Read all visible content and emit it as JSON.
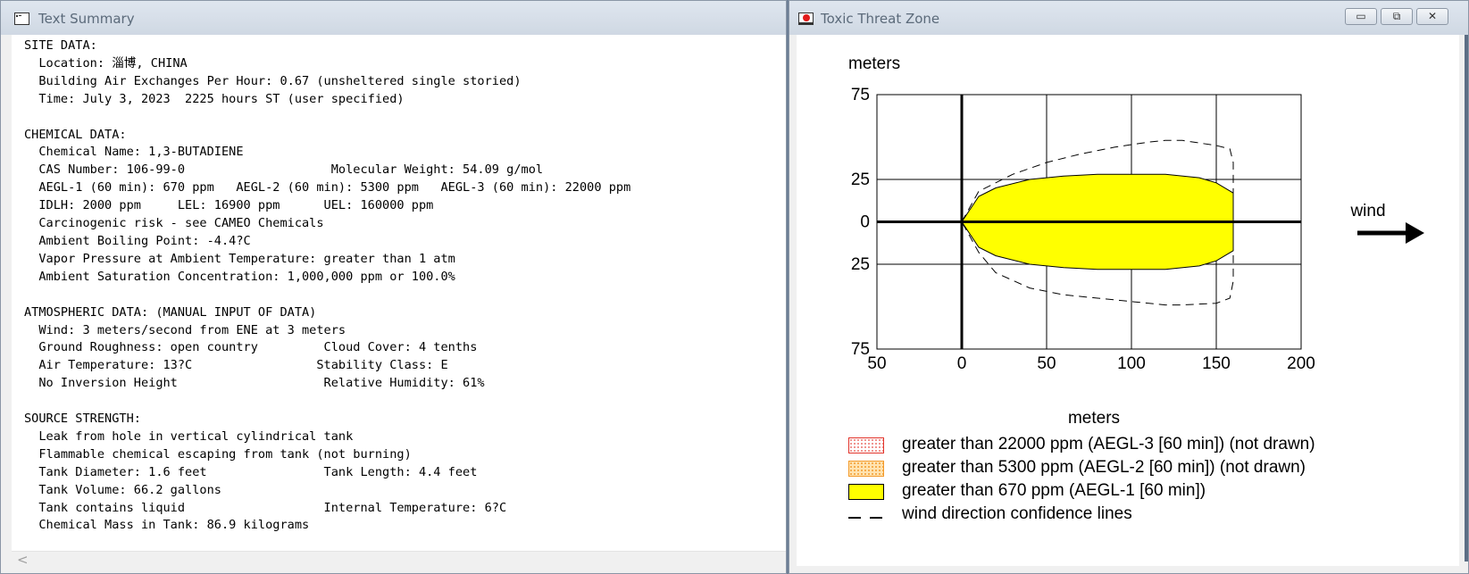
{
  "left_window": {
    "title": "Text Summary",
    "summary_text": "SITE DATA:\n  Location: 淄博, CHINA\n  Building Air Exchanges Per Hour: 0.67 (unsheltered single storied)\n  Time: July 3, 2023  2225 hours ST (user specified)\n\nCHEMICAL DATA:\n  Chemical Name: 1,3-BUTADIENE\n  CAS Number: 106-99-0                    Molecular Weight: 54.09 g/mol\n  AEGL-1 (60 min): 670 ppm   AEGL-2 (60 min): 5300 ppm   AEGL-3 (60 min): 22000 ppm\n  IDLH: 2000 ppm     LEL: 16900 ppm      UEL: 160000 ppm\n  Carcinogenic risk - see CAMEO Chemicals\n  Ambient Boiling Point: -4.4?C\n  Vapor Pressure at Ambient Temperature: greater than 1 atm\n  Ambient Saturation Concentration: 1,000,000 ppm or 100.0%\n\nATMOSPHERIC DATA: (MANUAL INPUT OF DATA)\n  Wind: 3 meters/second from ENE at 3 meters\n  Ground Roughness: open country         Cloud Cover: 4 tenths\n  Air Temperature: 13?C                 Stability Class: E\n  No Inversion Height                    Relative Humidity: 61%\n\nSOURCE STRENGTH:\n  Leak from hole in vertical cylindrical tank\n  Flammable chemical escaping from tank (not burning)\n  Tank Diameter: 1.6 feet                Tank Length: 4.4 feet\n  Tank Volume: 66.2 gallons\n  Tank contains liquid                   Internal Temperature: 6?C\n  Chemical Mass in Tank: 86.9 kilograms",
    "scroll_left_glyph": "<"
  },
  "right_window": {
    "title": "Toxic Threat Zone",
    "controls": {
      "minimize": "▭",
      "maximize": "⧉",
      "close": "✕"
    },
    "wind_label": "wind"
  },
  "chart_data": {
    "type": "area",
    "title": "",
    "ylabel": "meters",
    "xlabel": "meters",
    "xlim": [
      -50,
      200
    ],
    "ylim": [
      -75,
      75
    ],
    "x_ticks": [
      -50,
      0,
      50,
      100,
      150,
      200
    ],
    "x_tick_labels": [
      "50",
      "0",
      "50",
      "100",
      "150",
      "200"
    ],
    "y_ticks": [
      75,
      25,
      0,
      -25,
      -75
    ],
    "y_tick_labels": [
      "75",
      "25",
      "0",
      "25",
      "75"
    ],
    "grid": true,
    "series": [
      {
        "name": "greater than 670 ppm (AEGL-1 [60 min])",
        "kind": "filled_zone",
        "color": "#ffff00",
        "outline": [
          [
            0,
            0
          ],
          [
            10,
            15
          ],
          [
            20,
            20
          ],
          [
            40,
            25
          ],
          [
            60,
            27
          ],
          [
            80,
            28
          ],
          [
            100,
            28
          ],
          [
            120,
            28
          ],
          [
            140,
            26
          ],
          [
            150,
            23
          ],
          [
            160,
            17
          ],
          [
            160,
            -17
          ],
          [
            150,
            -23
          ],
          [
            140,
            -26
          ],
          [
            120,
            -28
          ],
          [
            100,
            -28
          ],
          [
            80,
            -28
          ],
          [
            60,
            -27
          ],
          [
            40,
            -25
          ],
          [
            20,
            -20
          ],
          [
            10,
            -15
          ]
        ]
      },
      {
        "name": "wind direction confidence lines",
        "kind": "dashed_line",
        "color": "#000000",
        "upper": [
          [
            0,
            0
          ],
          [
            10,
            18
          ],
          [
            30,
            28
          ],
          [
            50,
            35
          ],
          [
            70,
            40
          ],
          [
            90,
            44
          ],
          [
            110,
            47
          ],
          [
            120,
            48
          ],
          [
            130,
            48
          ],
          [
            150,
            45
          ],
          [
            158,
            43
          ],
          [
            160,
            35
          ],
          [
            160,
            -35
          ],
          [
            158,
            -45
          ],
          [
            150,
            -48
          ],
          [
            130,
            -49
          ],
          [
            120,
            -49
          ],
          [
            100,
            -47
          ],
          [
            80,
            -45
          ],
          [
            60,
            -43
          ],
          [
            40,
            -39
          ],
          [
            20,
            -30
          ],
          [
            10,
            -18
          ],
          [
            0,
            0
          ]
        ]
      }
    ],
    "legend": [
      {
        "label": "greater than 22000 ppm (AEGL-3 [60 min]) (not drawn)",
        "fill": "#ffffff",
        "border": "#e2342b",
        "pattern": "dots-red"
      },
      {
        "label": "greater than 5300 ppm (AEGL-2 [60 min]) (not drawn)",
        "fill": "#ffe3b0",
        "border": "#f39a2a",
        "pattern": "dots-orange"
      },
      {
        "label": "greater than 670 ppm (AEGL-1 [60 min])",
        "fill": "#ffff00",
        "border": "#000000",
        "pattern": "solid"
      },
      {
        "label": "wind direction confidence lines",
        "fill": "none",
        "border": "#000000",
        "pattern": "dash"
      }
    ],
    "legend_position": "bottom"
  }
}
